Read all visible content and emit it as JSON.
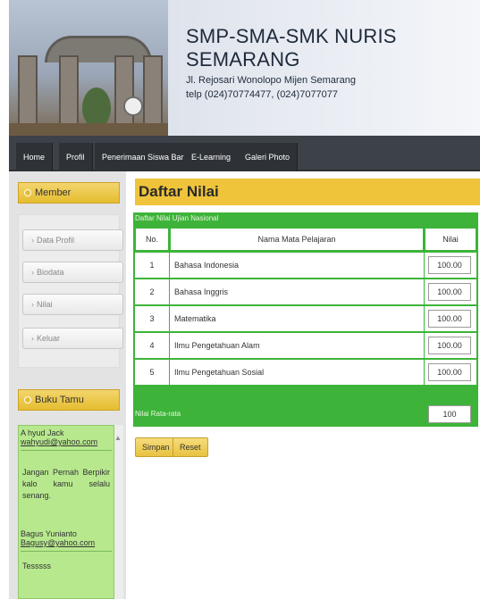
{
  "header": {
    "title": "SMP-SMA-SMK NURIS SEMARANG",
    "address": "Jl. Rejosari Wonolopo Mijen Semarang",
    "phone": "telp (024)70774477, (024)7077077"
  },
  "nav": [
    "Home",
    "Profil",
    "Penerimaan Siswa Baru",
    "E-Learning",
    "Galeri Photo"
  ],
  "sidebar": {
    "member_title": "Member",
    "member_items": [
      "Data Profil",
      "Biodata",
      "Nilai",
      "Keluar"
    ],
    "guestbook_title": "Buku Tamu",
    "entries": [
      {
        "name": "A hyud Jack",
        "email": "wahyudi@yahoo.com",
        "message": "Jangan Pernah Berpikir kalo kamu selalu senang."
      },
      {
        "name": "Bagus Yunianto",
        "email": "Bagusy@yahoo.com",
        "message": "Tesssss"
      }
    ]
  },
  "main": {
    "title": "Daftar Nilai",
    "caption": "Daftar Nilai Ujian Nasional",
    "headers": {
      "no": "No.",
      "subject": "Nama Mata Pelajaran",
      "score": "Nilai"
    },
    "rows": [
      {
        "no": "1",
        "subject": "Bahasa Indonesia",
        "score": "100.00"
      },
      {
        "no": "2",
        "subject": "Bahasa Inggris",
        "score": "100.00"
      },
      {
        "no": "3",
        "subject": "Matematika",
        "score": "100.00"
      },
      {
        "no": "4",
        "subject": "Ilmu Pengetahuan Alam",
        "score": "100.00"
      },
      {
        "no": "5",
        "subject": "Ilmu Pengetahuan Sosial",
        "score": "100.00"
      }
    ],
    "average_label": "Nilai Rata-rata",
    "average_value": "100",
    "buttons": {
      "save": "Simpan",
      "reset": "Reset"
    }
  },
  "colors": {
    "accent_yellow": "#efc43b",
    "table_green": "#3db439",
    "nav_dark": "#3d4248",
    "guest_green": "#b7e88e"
  }
}
